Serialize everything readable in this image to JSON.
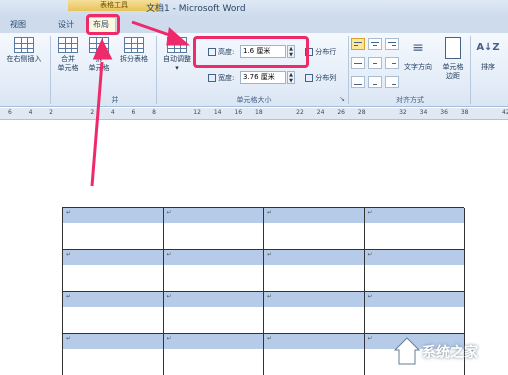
{
  "window": {
    "context_tab_header": "表格工具",
    "title": "文档1 - Microsoft Word"
  },
  "tabs": [
    {
      "label": "视图"
    },
    {
      "label": "设计"
    },
    {
      "label": "布局",
      "active": true
    }
  ],
  "ribbon": {
    "insert_right": "在右侧插入",
    "merge": {
      "line1": "合并",
      "line2": "单元格"
    },
    "split_cells": {
      "line1": "拆",
      "line2": "单元格"
    },
    "split_table": "拆分表格",
    "merge_group_label": "并",
    "autofit": "自动调整",
    "height_label": "高度:",
    "height_value": "1.6 厘米",
    "width_label": "宽度:",
    "width_value": "3.76 厘米",
    "distribute_rows": "分布行",
    "distribute_cols": "分布列",
    "cell_size_group_label": "单元格大小",
    "text_direction": "文字方向",
    "cell_margins": {
      "line1": "单元格",
      "line2": "边距"
    },
    "alignment_group_label": "对齐方式",
    "sort": "排序",
    "sort_icon_glyph": "A↓Z"
  },
  "ruler": {
    "marks": [
      "6",
      "4",
      "2",
      "",
      "2",
      "4",
      "6",
      "8",
      "",
      "12",
      "14",
      "16",
      "18",
      "",
      "22",
      "24",
      "26",
      "28",
      "",
      "32",
      "34",
      "36",
      "38",
      "",
      "42"
    ]
  },
  "table": {
    "rows": 4,
    "cols": 4,
    "cell_mark": "↵"
  },
  "watermark": {
    "text": "系统之家"
  },
  "colors": {
    "annotation": "#ee2a6a",
    "selection": "#b6cbe8",
    "context_tab": "#f0d278"
  }
}
